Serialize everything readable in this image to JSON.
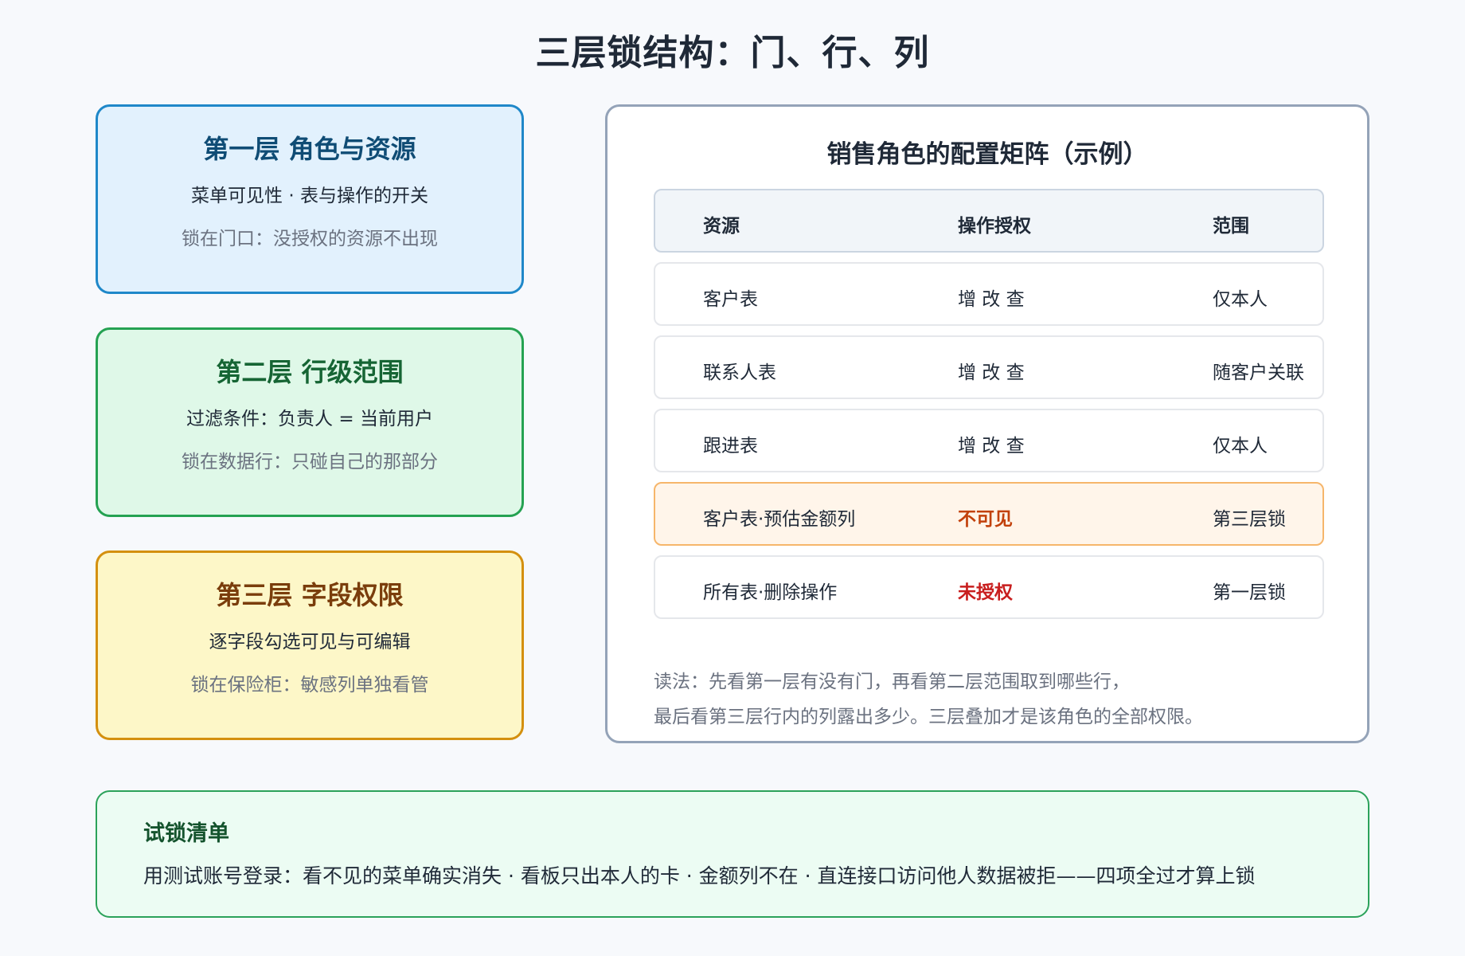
{
  "title": "三层锁结构：门、行、列",
  "layers": [
    {
      "heading": "第一层 角色与资源",
      "desc": "菜单可见性 · 表与操作的开关",
      "note": "锁在门口：没授权的资源不出现"
    },
    {
      "heading": "第二层 行级范围",
      "desc": "过滤条件：负责人 = 当前用户",
      "note": "锁在数据行：只碰自己的那部分"
    },
    {
      "heading": "第三层 字段权限",
      "desc": "逐字段勾选可见与可编辑",
      "note": "锁在保险柜：敏感列单独看管"
    }
  ],
  "matrix": {
    "title": "销售角色的配置矩阵（示例）",
    "columns": [
      "资源",
      "操作授权",
      "范围"
    ],
    "rows": [
      [
        "客户表",
        "增 改 查",
        "仅本人"
      ],
      [
        "联系人表",
        "增 改 查",
        "随客户关联"
      ],
      [
        "跟进表",
        "增 改 查",
        "仅本人"
      ],
      [
        "客户表·预估金额列",
        "不可见",
        "第三层锁"
      ],
      [
        "所有表·删除操作",
        "未授权",
        "第一层锁"
      ]
    ],
    "reading_line1": "读法：先看第一层有没有门，再看第二层范围取到哪些行，",
    "reading_line2": "最后看第三层行内的列露出多少。三层叠加才是该角色的全部权限。"
  },
  "checklist": {
    "title": "试锁清单",
    "text": "用测试账号登录：看不见的菜单确实消失 · 看板只出本人的卡 · 金额列不在 · 直连接口访问他人数据被拒——四项全过才算上锁"
  }
}
